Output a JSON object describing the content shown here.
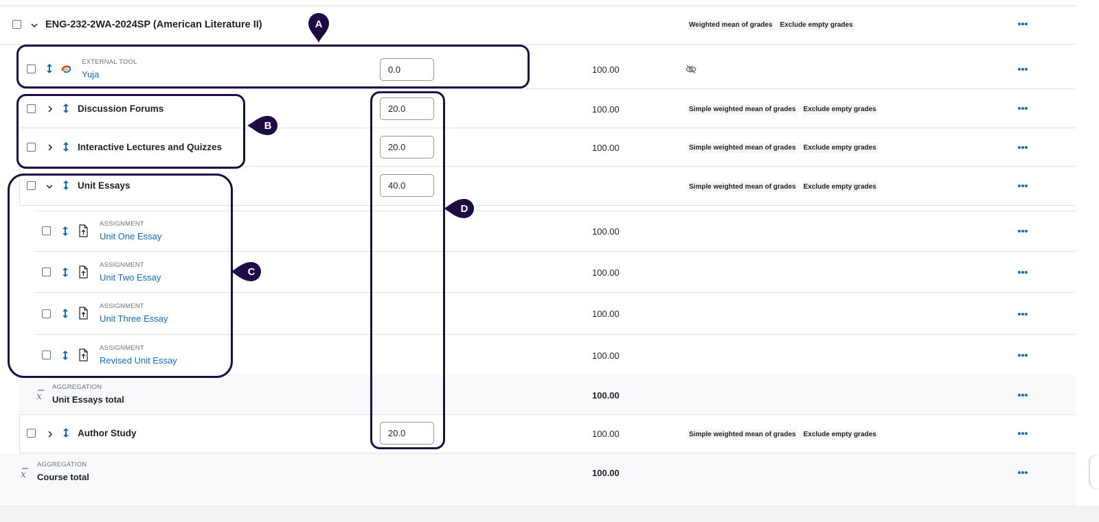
{
  "course": {
    "title": "ENG-232-2WA-2024SP (American Literature II)",
    "badges": [
      "Weighted mean of grades",
      "Exclude empty grades"
    ]
  },
  "items": {
    "yuja": {
      "type": "EXTERNAL TOOL",
      "name": "Yuja",
      "weight": "0.0",
      "max": "100.00"
    },
    "discussion": {
      "name": "Discussion Forums",
      "weight": "20.0",
      "max": "100.00",
      "badges": [
        "Simple weighted mean of grades",
        "Exclude empty grades"
      ]
    },
    "lectures": {
      "name": "Interactive Lectures and Quizzes",
      "weight": "20.0",
      "max": "100.00",
      "badges": [
        "Simple weighted mean of grades",
        "Exclude empty grades"
      ]
    },
    "unit_essays": {
      "name": "Unit Essays",
      "weight": "40.0",
      "badges": [
        "Simple weighted mean of grades",
        "Exclude empty grades"
      ]
    },
    "essay1": {
      "type": "ASSIGNMENT",
      "name": "Unit One Essay",
      "max": "100.00"
    },
    "essay2": {
      "type": "ASSIGNMENT",
      "name": "Unit Two Essay",
      "max": "100.00"
    },
    "essay3": {
      "type": "ASSIGNMENT",
      "name": "Unit Three Essay",
      "max": "100.00"
    },
    "essay4": {
      "type": "ASSIGNMENT",
      "name": "Revised Unit Essay",
      "max": "100.00"
    },
    "unit_total": {
      "type": "AGGREGATION",
      "name": "Unit Essays total",
      "max": "100.00"
    },
    "author_study": {
      "name": "Author Study",
      "weight": "20.0",
      "max": "100.00",
      "badges": [
        "Simple weighted mean of grades",
        "Exclude empty grades"
      ]
    },
    "course_total": {
      "type": "AGGREGATION",
      "name": "Course total",
      "max": "100.00"
    }
  },
  "callouts": {
    "a": "A",
    "b": "B",
    "c": "C",
    "d": "D"
  },
  "icons": {
    "move": "move-arrows-icon",
    "yuja": "yuja-logo-icon",
    "assignment": "assignment-upload-icon",
    "aggregation": "x-bar-mean-icon",
    "hidden": "eye-slash-icon",
    "menu": "ellipsis-menu-icon"
  },
  "colors": {
    "link": "#0f6cbf",
    "callout": "#1e0b45",
    "text": "#1d2125"
  }
}
